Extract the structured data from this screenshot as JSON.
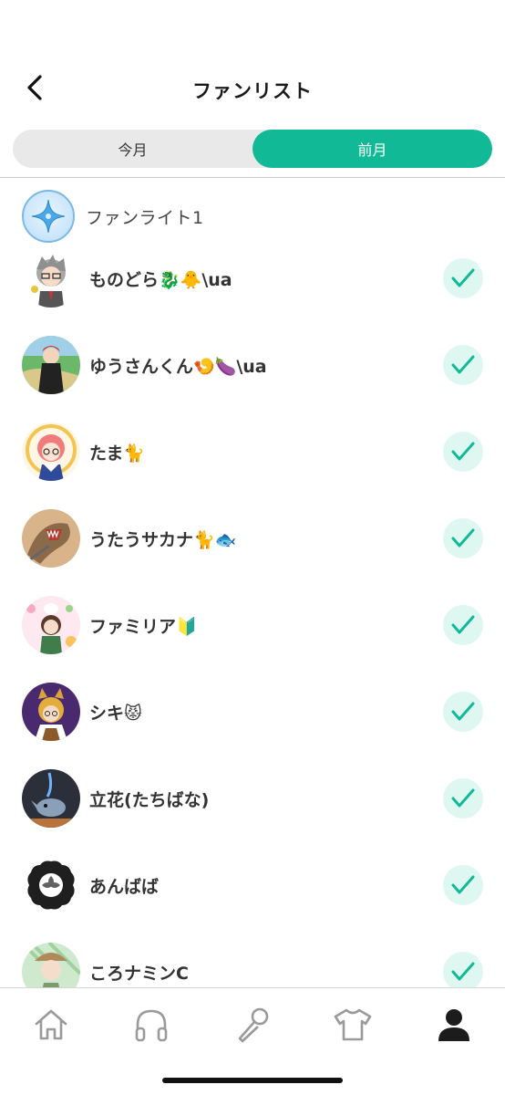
{
  "header": {
    "title": "ファンリスト"
  },
  "segment": {
    "tabs": [
      "今月",
      "前月"
    ],
    "active_index": 1
  },
  "rank": {
    "label": "ファンライト1"
  },
  "fans": [
    {
      "name": "ものどら🐉🐥\\ua",
      "checked": true
    },
    {
      "name": "ゆうさんくん🍤🍆\\ua",
      "checked": true
    },
    {
      "name": "たま🐈",
      "checked": true
    },
    {
      "name": "うたうサカナ🐈🐟",
      "checked": true
    },
    {
      "name": "ファミリア🔰",
      "checked": true
    },
    {
      "name": "シキ😾",
      "checked": true
    },
    {
      "name": "立花(たちばな)",
      "checked": true
    },
    {
      "name": "あんばば",
      "checked": true
    },
    {
      "name": "ころナミンC",
      "checked": true
    }
  ],
  "tabbar": {
    "items": [
      "home-icon",
      "headphones-icon",
      "microphone-icon",
      "tshirt-icon",
      "profile-icon"
    ],
    "active_index": 4
  },
  "colors": {
    "accent": "#12b997",
    "check_bg": "#dff7f1",
    "segment_bg": "#e9e9e9"
  }
}
